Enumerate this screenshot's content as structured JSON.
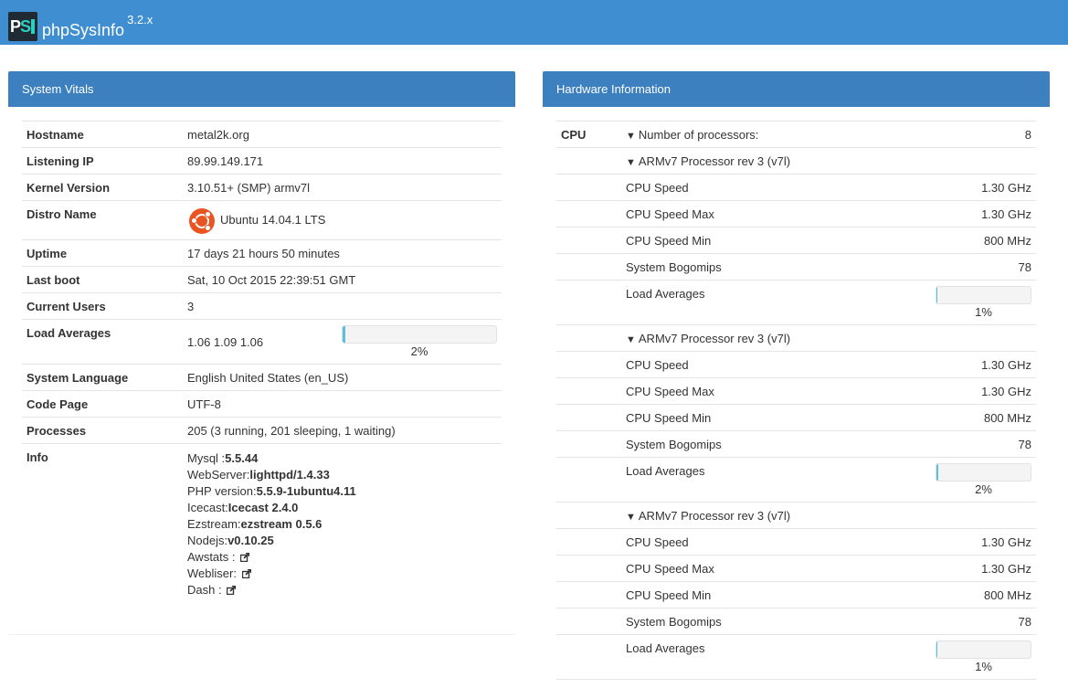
{
  "header": {
    "app_name": "phpSysInfo",
    "version": "3.2.x",
    "logo_p": "P",
    "logo_s": "S"
  },
  "vitals": {
    "title": "System Vitals",
    "rows": [
      {
        "label": "Hostname",
        "value": "metal2k.org"
      },
      {
        "label": "Listening IP",
        "value": "89.99.149.171"
      },
      {
        "label": "Kernel Version",
        "value": "3.10.51+ (SMP) armv7l"
      },
      {
        "label": "Distro Name",
        "value": "Ubuntu 14.04.1 LTS"
      },
      {
        "label": "Uptime",
        "value": "17 days 21 hours 50 minutes"
      },
      {
        "label": "Last boot",
        "value": "Sat, 10 Oct 2015 22:39:51 GMT"
      },
      {
        "label": "Current Users",
        "value": "3"
      },
      {
        "label": "Load Averages",
        "value": "1.06 1.09 1.06",
        "percent_text": "2%",
        "percent": 2
      },
      {
        "label": "System Language",
        "value": "English United States (en_US)"
      },
      {
        "label": "Code Page",
        "value": "UTF-8"
      },
      {
        "label": "Processes",
        "value": "205 (3 running, 201 sleeping, 1 waiting)"
      }
    ],
    "info": {
      "label": "Info",
      "items": [
        {
          "name": "Mysql :",
          "value": "5.5.44"
        },
        {
          "name": "WebServer:",
          "value": "lighttpd/1.4.33"
        },
        {
          "name": "PHP version:",
          "value": "5.5.9-1ubuntu4.11"
        },
        {
          "name": "Icecast:",
          "value": "Icecast 2.4.0"
        },
        {
          "name": "Ezstream:",
          "value": "ezstream 0.5.6"
        },
        {
          "name": "Nodejs:",
          "value": "v0.10.25"
        },
        {
          "name": "Awstats :",
          "link_icon": "external-link-icon"
        },
        {
          "name": "Webliser:",
          "link_icon": "external-link-icon"
        },
        {
          "name": "Dash :",
          "link_icon": "external-link-icon"
        }
      ]
    }
  },
  "hardware": {
    "title": "Hardware Information",
    "cpu_label": "CPU",
    "num_processors_label": "Number of processors:",
    "num_processors": "8",
    "processors": [
      {
        "name": "ARMv7 Processor rev 3 (v7l)",
        "speed": "1.30 GHz",
        "speed_max": "1.30 GHz",
        "speed_min": "800 MHz",
        "bogomips": "78",
        "load_text": "1%",
        "load": 1
      },
      {
        "name": "ARMv7 Processor rev 3 (v7l)",
        "speed": "1.30 GHz",
        "speed_max": "1.30 GHz",
        "speed_min": "800 MHz",
        "bogomips": "78",
        "load_text": "2%",
        "load": 2
      },
      {
        "name": "ARMv7 Processor rev 3 (v7l)",
        "speed": "1.30 GHz",
        "speed_max": "1.30 GHz",
        "speed_min": "800 MHz",
        "bogomips": "78",
        "load_text": "1%",
        "load": 1
      }
    ],
    "labels": {
      "speed": "CPU Speed",
      "speed_max": "CPU Speed Max",
      "speed_min": "CPU Speed Min",
      "bogomips": "System Bogomips",
      "load": "Load Averages"
    }
  },
  "colors": {
    "topbar": "#3f8ed1",
    "panel_header": "#3c80bf",
    "bar_fill": "#5bc0de",
    "ubuntu": "#e95420"
  }
}
